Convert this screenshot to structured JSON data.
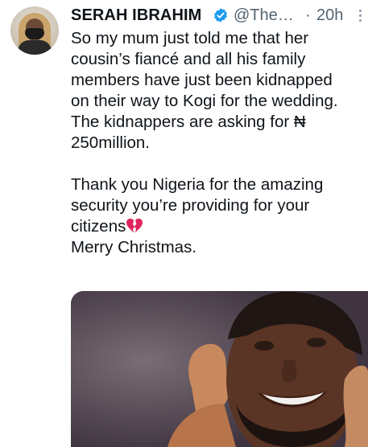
{
  "author": {
    "display_name": "SERAH IBRAHIM",
    "handle": "@The…",
    "separator": "·",
    "timestamp": "20h",
    "verified": true
  },
  "tweet": {
    "paragraph1": [
      "So my mum just told me that her",
      "cousin’s fiancé and all his family",
      "members have just been kidnapped",
      "on their way to Kogi for the wedding.",
      "The kidnappers are asking for ₦",
      "250million."
    ],
    "paragraph2": [
      "Thank you Nigeria for the amazing",
      "security you’re providing for your",
      "citizens",
      "Merry Christmas."
    ],
    "emoji": "broken-heart-icon"
  },
  "icons": {
    "verified": "verified-badge-icon",
    "more": "more-vertical-icon"
  },
  "colors": {
    "text": "#0f1419",
    "secondary": "#536471",
    "verified": "#1d9bf0",
    "emoji": "#e0245e"
  }
}
